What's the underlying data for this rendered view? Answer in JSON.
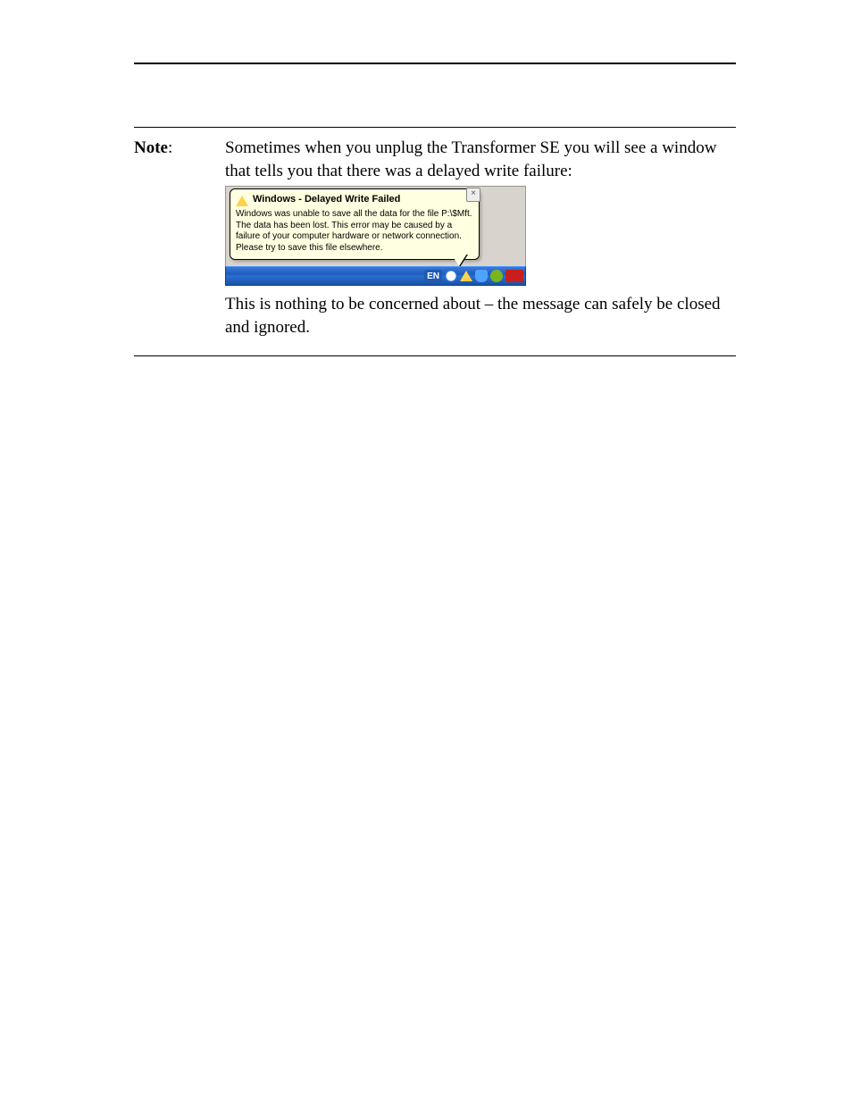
{
  "note": {
    "label": "Note",
    "intro": "Sometimes when you unplug the Transformer SE you will see a window that tells you that there was a delayed write failure:",
    "outro": "This is nothing to be concerned about – the message can safely be closed and ignored."
  },
  "balloon": {
    "title": "Windows - Delayed Write Failed",
    "body": "Windows was unable to save all the data for the file P:\\$Mft. The data has been lost. This error may be caused by a failure of your computer hardware or network connection. Please try to save this file elsewhere.",
    "close_label": "×"
  },
  "taskbar": {
    "language": "EN"
  }
}
